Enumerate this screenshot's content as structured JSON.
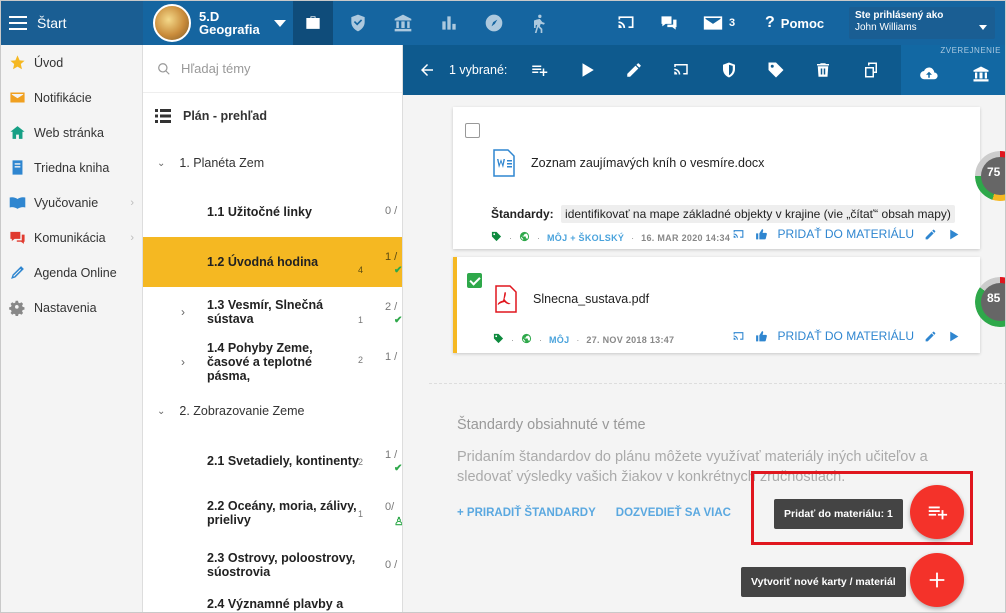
{
  "topbar": {
    "start_label": "Štart",
    "class_name": "5.D",
    "subject": "Geografia",
    "mail_count": "3",
    "help_label": "Pomoc",
    "logged_in_label": "Ste prihlásený ako",
    "user_name": "John Williams"
  },
  "leftnav": {
    "items": [
      {
        "label": "Úvod",
        "icon": "star-icon"
      },
      {
        "label": "Notifikácie",
        "icon": "envelope-icon"
      },
      {
        "label": "Web stránka",
        "icon": "home-icon"
      },
      {
        "label": "Triedna kniha",
        "icon": "book-icon"
      },
      {
        "label": "Vyučovanie",
        "icon": "open-book-icon"
      },
      {
        "label": "Komunikácia",
        "icon": "chat-icon"
      },
      {
        "label": "Agenda Online",
        "icon": "pen-icon"
      },
      {
        "label": "Nastavenia",
        "icon": "gear-icon"
      }
    ]
  },
  "topics": {
    "search_placeholder": "Hľadaj témy",
    "plan_label": "Plán - prehľad",
    "ch1": "1. Planéta Zem",
    "ch2": "2. Zobrazovanie Zeme",
    "l11": {
      "title": "1.1 Užitočné linky",
      "frac": "0 /"
    },
    "l12": {
      "title": "1.2 Úvodná hodina",
      "count": "4",
      "frac": "1 /",
      "check": "✔"
    },
    "l13": {
      "title": "1.3 Vesmír, Slnečná sústava",
      "count": "1",
      "frac": "2 /",
      "check": "✔"
    },
    "l14": {
      "title": "1.4 Pohyby Zeme, časové a teplotné pásma,",
      "count": "2",
      "frac": "1 /"
    },
    "l21": {
      "title": "2.1 Svetadiely, kontinenty",
      "count": "2",
      "frac": "1 /",
      "check": "✔"
    },
    "l22": {
      "title": "2.2 Oceány, moria, zálivy, prielivy",
      "count": "1",
      "frac": "0/"
    },
    "l23": {
      "title": "2.3 Ostrovy, poloostrovy, súostrovia",
      "frac": "0 /"
    },
    "l24": {
      "title": "2.4 Významné plavby a"
    }
  },
  "action_bar": {
    "selected": "1 vybrané:",
    "published_label": "ZVEREJNENIE"
  },
  "cards": [
    {
      "file": "Zoznam zaujímavých kníh o vesmíre.docx",
      "standards_label": "Štandardy:",
      "standard": "identifikovať na mape základné objekty v krajine (vie „čítať“ obsah mapy)",
      "source": "MÔJ + ŠKOLSKÝ",
      "date": "16. MAR 2020 14:34",
      "action": "PRIDAŤ DO MATERIÁLU",
      "score": "75"
    },
    {
      "file": "Slnecna_sustava.pdf",
      "source": "MÔJ",
      "date": "27. NOV 2018 13:47",
      "action": "PRIDAŤ DO MATERIÁLU",
      "score": "85"
    }
  ],
  "standards_section": {
    "title": "Štandardy obsiahnuté v téme",
    "desc": "Pridaním štandardov do plánu môžete využívať materiály iných učiteľov a sledovať výsledky vašich žiakov v konkrétnych zručnostiach.",
    "assign_link": "+ PRIRADIŤ ŠTANDARDY",
    "more_link": "DOZVEDIEŤ SA VIAC"
  },
  "fab": {
    "add_tooltip": "Pridať do materiálu: 1",
    "create_tooltip": "Vytvoriť nové karty / materiál"
  },
  "colors": {
    "topbar": "#1565a0",
    "selected_lesson": "#f5b822",
    "fab": "#f4322a",
    "highlight": "#e0161e"
  }
}
